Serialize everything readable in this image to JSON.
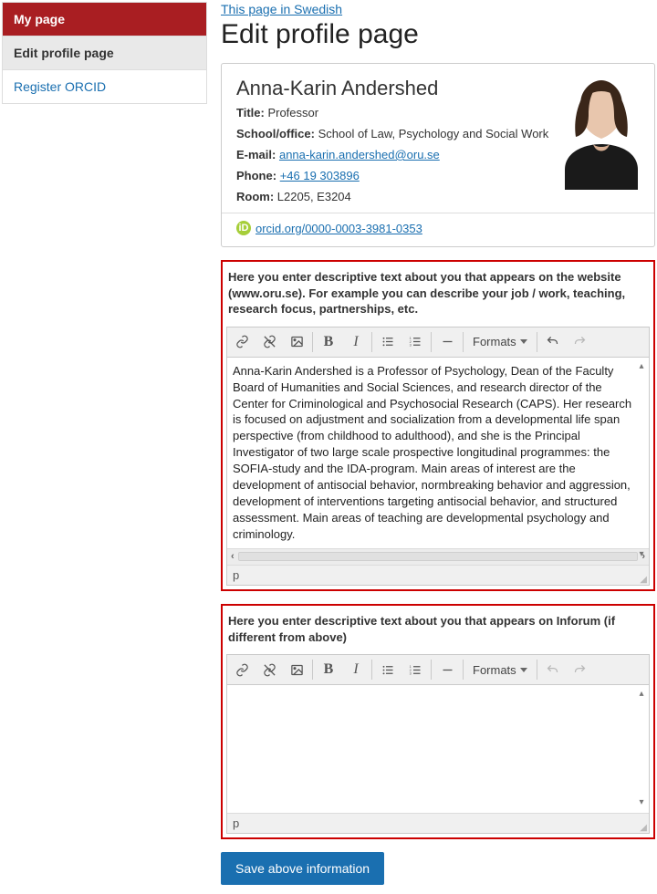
{
  "sidebar": {
    "items": [
      {
        "label": "My page"
      },
      {
        "label": "Edit profile page"
      },
      {
        "label": "Register ORCID"
      }
    ]
  },
  "header": {
    "lang_link": "This page in Swedish",
    "title": "Edit profile page"
  },
  "profile": {
    "name": "Anna-Karin Andershed",
    "title_k": "Title:",
    "title_v": "Professor",
    "school_k": "School/office:",
    "school_v": "School of Law, Psychology and Social Work",
    "email_k": "E-mail:",
    "email_v": "anna-karin.andershed@oru.se",
    "phone_k": "Phone:",
    "phone_v": "+46 19 303896",
    "room_k": "Room:",
    "room_v": "L2205, E3204",
    "orcid_label": " orcid.org/0000-0003-3981-0353"
  },
  "editor1": {
    "label": "Here you enter descriptive text about you that appears on the website (www.oru.se). For example you can describe your job / work, teaching, research focus, partnerships, etc.",
    "content": "Anna-Karin Andershed is a Professor of Psychology, Dean of the Faculty Board of Humanities and Social Sciences, and research director of the Center for Criminological and Psychosocial Research (CAPS). Her research is focused on adjustment and socialization from a developmental life span perspective (from childhood to adulthood), and she is the Principal Investigator of two large scale prospective longitudinal programmes: the SOFIA-study and the IDA-program. Main areas of interest are the development of antisocial behavior, normbreaking behavior and aggression, development of interventions targeting antisocial behavior, and structured assessment. Main areas of teaching are developmental psychology and criminology.",
    "path": "p"
  },
  "editor2": {
    "label": "Here you enter descriptive text about you that appears on Inforum (if different from above)",
    "content": "",
    "path": "p"
  },
  "toolbar": {
    "formats": "Formats"
  },
  "button": {
    "save": "Save above information"
  }
}
